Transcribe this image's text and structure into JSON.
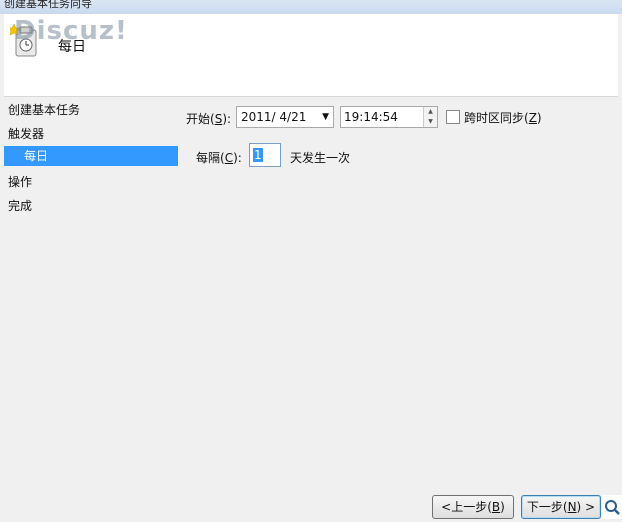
{
  "window": {
    "title": "创建基本任务向导"
  },
  "header": {
    "title": "每日",
    "watermark": "Discuz!"
  },
  "nav": {
    "items": [
      {
        "label": "创建基本任务",
        "selected": false,
        "indent": false
      },
      {
        "label": "触发器",
        "selected": false,
        "indent": false
      },
      {
        "label": "每日",
        "selected": true,
        "indent": true
      },
      {
        "label": "操作",
        "selected": false,
        "indent": false
      },
      {
        "label": "完成",
        "selected": false,
        "indent": false
      }
    ]
  },
  "form": {
    "start_label": "开始(",
    "start_key": "S",
    "start_tail": "):",
    "date_value": "2011/ 4/21",
    "time_value": "19:14:54",
    "sync_label": "跨时区同步(",
    "sync_key": "Z",
    "sync_tail": ")",
    "sync_checked": false,
    "every_label": "每隔(",
    "every_key": "C",
    "every_tail": "):",
    "every_value": "1",
    "every_suffix": "天发生一次"
  },
  "buttons": {
    "prev": "<上一步(",
    "prev_key": "B",
    "prev_tail": ")",
    "next": "下一步(",
    "next_key": "N",
    "next_tail": ") >"
  },
  "colors": {
    "selection": "#3399ff",
    "background": "#f0f0f0"
  },
  "icons": {
    "header": "task-scheduler-icon",
    "date": "dropdown-arrow-icon",
    "zoom": "magnifier-icon"
  }
}
